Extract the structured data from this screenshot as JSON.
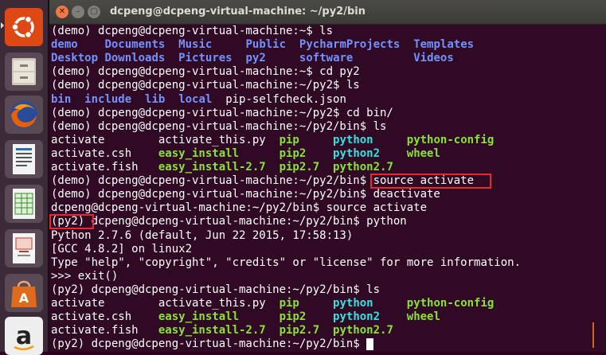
{
  "window": {
    "title": "dcpeng@dcpeng-virtual-machine: ~/py2/bin",
    "buttons": {
      "close": "✕",
      "minimize": "–",
      "maximize": "▢"
    }
  },
  "launcher": {
    "items": [
      {
        "name": "ubuntu-dash",
        "icon": "ubuntu-logo-icon",
        "color": "#dd4814"
      },
      {
        "name": "files",
        "icon": "file-cabinet-icon",
        "color": "#a89a83"
      },
      {
        "name": "firefox",
        "icon": "firefox-icon",
        "color": "#e66000"
      },
      {
        "name": "writer",
        "icon": "document-icon",
        "color": "#2b6cb0"
      },
      {
        "name": "calc",
        "icon": "spreadsheet-icon",
        "color": "#3a8a2a"
      },
      {
        "name": "impress",
        "icon": "presentation-icon",
        "color": "#c0392b"
      },
      {
        "name": "software-center",
        "icon": "shopping-bag-icon",
        "color": "#e06a1b"
      },
      {
        "name": "amazon",
        "icon": "amazon-icon",
        "color": "#eeeeee"
      }
    ]
  },
  "colors": {
    "background": "#300a24",
    "text": "#ffffff",
    "directory": "#7292ff",
    "executable": "#8ae234",
    "symlink": "#34e2e2",
    "highlight": "#e8282e"
  },
  "terminal": {
    "lines": [
      [
        [
          "(demo) dcpeng@dcpeng-virtual-machine:~$ ls",
          "pln"
        ]
      ],
      [
        [
          "demo",
          "dir"
        ],
        [
          "    ",
          "pln"
        ],
        [
          "Documents",
          "dir"
        ],
        [
          "  ",
          "pln"
        ],
        [
          "Music",
          "dir"
        ],
        [
          "     ",
          "pln"
        ],
        [
          "Public",
          "dir"
        ],
        [
          "  ",
          "pln"
        ],
        [
          "PycharmProjects",
          "dir"
        ],
        [
          "  ",
          "pln"
        ],
        [
          "Templates",
          "dir"
        ]
      ],
      [
        [
          "Desktop",
          "dir"
        ],
        [
          " ",
          "pln"
        ],
        [
          "Downloads",
          "dir"
        ],
        [
          "  ",
          "pln"
        ],
        [
          "Pictures",
          "dir"
        ],
        [
          "  ",
          "pln"
        ],
        [
          "py2",
          "dir"
        ],
        [
          "     ",
          "pln"
        ],
        [
          "software",
          "dir"
        ],
        [
          "         ",
          "pln"
        ],
        [
          "Videos",
          "dir"
        ]
      ],
      [
        [
          "(demo) dcpeng@dcpeng-virtual-machine:~$ cd py2",
          "pln"
        ]
      ],
      [
        [
          "(demo) dcpeng@dcpeng-virtual-machine:~/py2$ ls",
          "pln"
        ]
      ],
      [
        [
          "bin",
          "dir"
        ],
        [
          "  ",
          "pln"
        ],
        [
          "include",
          "dir"
        ],
        [
          "  ",
          "pln"
        ],
        [
          "lib",
          "dir"
        ],
        [
          "  ",
          "pln"
        ],
        [
          "local",
          "dir"
        ],
        [
          "  pip-selfcheck.json",
          "pln"
        ]
      ],
      [
        [
          "(demo) dcpeng@dcpeng-virtual-machine:~/py2$ cd bin/",
          "pln"
        ]
      ],
      [
        [
          "(demo) dcpeng@dcpeng-virtual-machine:~/py2/bin$ ls",
          "pln"
        ]
      ],
      [
        [
          "activate        activate_this.py  ",
          "pln"
        ],
        [
          "pip",
          "exe"
        ],
        [
          "     ",
          "pln"
        ],
        [
          "python",
          "link"
        ],
        [
          "     ",
          "pln"
        ],
        [
          "python-config",
          "exe"
        ]
      ],
      [
        [
          "activate.csh    ",
          "pln"
        ],
        [
          "easy_install",
          "exe"
        ],
        [
          "      ",
          "pln"
        ],
        [
          "pip2",
          "exe"
        ],
        [
          "    ",
          "pln"
        ],
        [
          "python2",
          "link"
        ],
        [
          "    ",
          "pln"
        ],
        [
          "wheel",
          "exe"
        ]
      ],
      [
        [
          "activate.fish   ",
          "pln"
        ],
        [
          "easy_install-2.7",
          "exe"
        ],
        [
          "  ",
          "pln"
        ],
        [
          "pip2.7",
          "exe"
        ],
        [
          "  ",
          "pln"
        ],
        [
          "python2.7",
          "exe"
        ]
      ],
      [
        [
          "(demo) dcpeng@dcpeng-virtual-machine:~/py2/bin$ source activate",
          "pln"
        ]
      ],
      [
        [
          "(demo) dcpeng@dcpeng-virtual-machine:~/py2/bin$ deactivate",
          "pln"
        ]
      ],
      [
        [
          "dcpeng@dcpeng-virtual-machine:~/py2/bin$ source activate",
          "pln"
        ]
      ],
      [
        [
          "(py2) dcpeng@dcpeng-virtual-machine:~/py2/bin$ python",
          "pln"
        ]
      ],
      [
        [
          "Python 2.7.6 (default, Jun 22 2015, 17:58:13)",
          "pln"
        ]
      ],
      [
        [
          "[GCC 4.8.2] on linux2",
          "pln"
        ]
      ],
      [
        [
          "Type \"help\", \"copyright\", \"credits\" or \"license\" for more information.",
          "pln"
        ]
      ],
      [
        [
          ">>> exit()",
          "pln"
        ]
      ],
      [
        [
          "(py2) dcpeng@dcpeng-virtual-machine:~/py2/bin$ ls",
          "pln"
        ]
      ],
      [
        [
          "activate        activate_this.py  ",
          "pln"
        ],
        [
          "pip",
          "exe"
        ],
        [
          "     ",
          "pln"
        ],
        [
          "python",
          "link"
        ],
        [
          "     ",
          "pln"
        ],
        [
          "python-config",
          "exe"
        ]
      ],
      [
        [
          "activate.csh    ",
          "pln"
        ],
        [
          "easy_install",
          "exe"
        ],
        [
          "      ",
          "pln"
        ],
        [
          "pip2",
          "exe"
        ],
        [
          "    ",
          "pln"
        ],
        [
          "python2",
          "link"
        ],
        [
          "    ",
          "pln"
        ],
        [
          "wheel",
          "exe"
        ]
      ],
      [
        [
          "activate.fish   ",
          "pln"
        ],
        [
          "easy_install-2.7",
          "exe"
        ],
        [
          "  ",
          "pln"
        ],
        [
          "pip2.7",
          "exe"
        ],
        [
          "  ",
          "pln"
        ],
        [
          "python2.7",
          "exe"
        ]
      ],
      [
        [
          "(py2) dcpeng@dcpeng-virtual-machine:~/py2/bin$ ",
          "pln"
        ]
      ]
    ]
  },
  "annotations": [
    {
      "name": "highlight-source-activate",
      "text": "source activate"
    },
    {
      "name": "highlight-py2-prefix",
      "text": "(py2)"
    }
  ]
}
